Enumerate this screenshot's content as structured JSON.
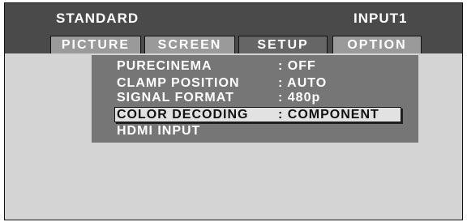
{
  "header": {
    "mode": "STANDARD",
    "input": "INPUT1"
  },
  "tabs": [
    {
      "label": "PICTURE",
      "active": false
    },
    {
      "label": "SCREEN",
      "active": false
    },
    {
      "label": "SETUP",
      "active": true
    },
    {
      "label": "OPTION",
      "active": false
    }
  ],
  "menu": {
    "items": [
      {
        "label": "PURECINEMA",
        "value": ": OFF"
      },
      {
        "label": "CLAMP POSITION",
        "value": ": AUTO"
      },
      {
        "label": "SIGNAL FORMAT",
        "value": ": 480p"
      },
      {
        "label": "COLOR DECODING",
        "value": ": COMPONENT",
        "selected": true
      },
      {
        "label": "HDMI INPUT",
        "value": ""
      }
    ]
  },
  "colors": {
    "header_bg": "#4a4a4a",
    "screen_bg": "#d4d4d4",
    "menu_bg": "#767676",
    "active_tab": "#666666",
    "inactive_tab": "#9a9a9a",
    "selection_bg": "#e2e2e2"
  }
}
